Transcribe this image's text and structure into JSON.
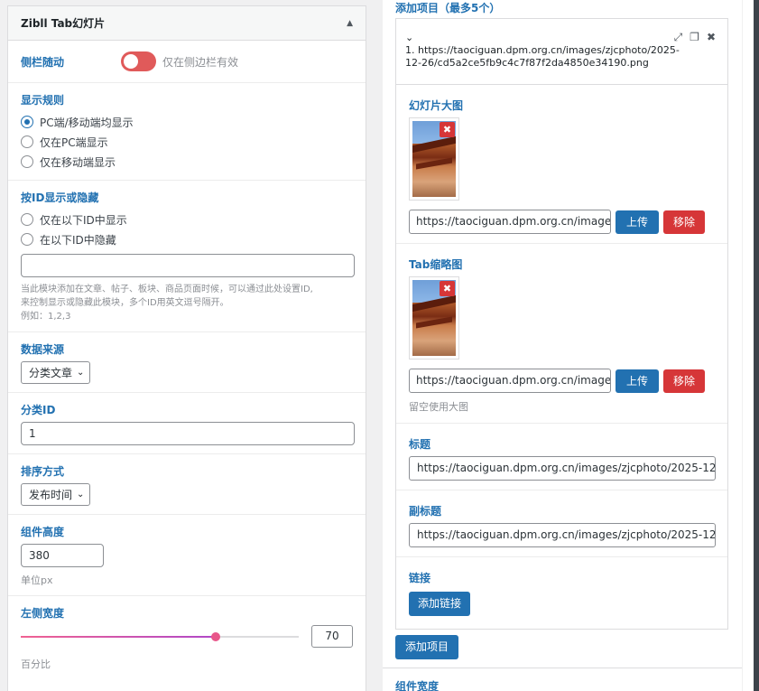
{
  "widget": {
    "title": "Zibll Tab幻灯片",
    "collapse_icon": "triangle-up-icon",
    "sidebar_follow": {
      "label": "侧栏随动",
      "hint": "仅在侧边栏有效",
      "enabled": false
    },
    "display_rule": {
      "label": "显示规则",
      "options": [
        "PC端/移动端均显示",
        "仅在PC端显示",
        "仅在移动端显示"
      ],
      "selected": 0
    },
    "id_rule": {
      "label": "按ID显示或隐藏",
      "options": [
        "仅在以下ID中显示",
        "在以下ID中隐藏"
      ],
      "input_value": "",
      "desc_line1": "当此模块添加在文章、帖子、板块、商品页面时候，可以通过此处设置ID,",
      "desc_line2": "来控制显示或隐藏此模块，多个ID用英文逗号隔开。",
      "desc_line3": "例如：1,2,3"
    },
    "data_source": {
      "label": "数据来源",
      "value": "分类文章"
    },
    "category_id": {
      "label": "分类ID",
      "value": "1"
    },
    "sort": {
      "label": "排序方式",
      "value": "发布时间"
    },
    "height": {
      "label": "组件高度",
      "value": "380",
      "unit": "单位px"
    },
    "left_width": {
      "label": "左侧宽度",
      "value": "70",
      "percent": 70,
      "unit": "百分比"
    }
  },
  "items": {
    "header": "添加项目（最多5个）",
    "item1": {
      "title_line1": "1. https://taociguan.dpm.org.cn/images/zjcphoto/2025-",
      "title_line2": "12-26/cd5a2ce5fb9c4c7f87f2da4850e34190.png",
      "large_image": {
        "label": "幻灯片大图",
        "url": "https://taociguan.dpm.org.cn/image",
        "upload": "上传",
        "remove": "移除"
      },
      "tab_thumb": {
        "label": "Tab缩略图",
        "url": "https://taociguan.dpm.org.cn/image",
        "upload": "上传",
        "remove": "移除",
        "hint": "留空使用大图"
      },
      "title": {
        "label": "标题",
        "value": "https://taociguan.dpm.org.cn/images/zjcphoto/2025-12-"
      },
      "subtitle": {
        "label": "副标题",
        "value": "https://taociguan.dpm.org.cn/images/zjcphoto/2025-12-"
      },
      "link": {
        "label": "链接",
        "button": "添加链接"
      }
    },
    "add_button": "添加项目",
    "next_field_label": "组件宽度"
  },
  "colors": {
    "accent": "#2271b1",
    "danger": "#d63638",
    "toggle_off": "#e05a5a"
  }
}
